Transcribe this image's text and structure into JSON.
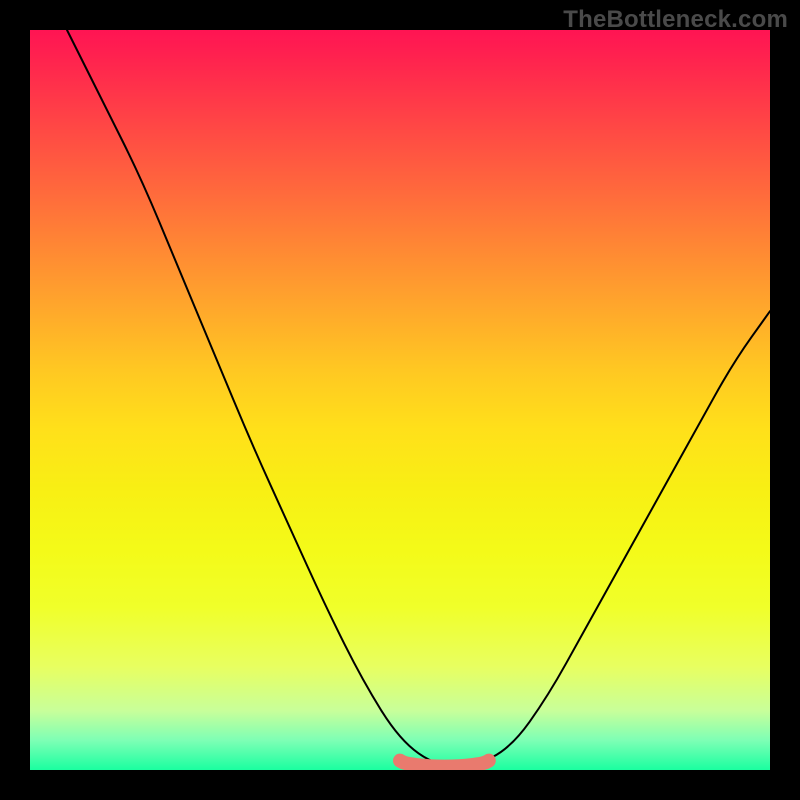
{
  "watermark": "TheBottleneck.com",
  "chart_data": {
    "type": "line",
    "title": "",
    "xlabel": "",
    "ylabel": "",
    "xlim": [
      0,
      100
    ],
    "ylim": [
      0,
      100
    ],
    "grid": false,
    "legend": false,
    "series": [
      {
        "name": "bottleneck-curve",
        "x": [
          5,
          10,
          15,
          20,
          25,
          30,
          35,
          40,
          45,
          50,
          55,
          60,
          65,
          70,
          75,
          80,
          85,
          90,
          95,
          100
        ],
        "y": [
          100,
          90,
          80,
          68,
          56,
          44,
          33,
          22,
          12,
          4,
          0.5,
          0.5,
          3,
          10,
          19,
          28,
          37,
          46,
          55,
          62
        ]
      }
    ],
    "annotations": [
      {
        "name": "optimal-range",
        "x_range": [
          50,
          62
        ],
        "y": 1,
        "color": "#e97a6e"
      }
    ],
    "background": {
      "gradient": "vertical",
      "stops": [
        {
          "pos": 0.0,
          "color": "#ff1453"
        },
        {
          "pos": 0.5,
          "color": "#ffe01a"
        },
        {
          "pos": 1.0,
          "color": "#1affa0"
        }
      ]
    }
  }
}
